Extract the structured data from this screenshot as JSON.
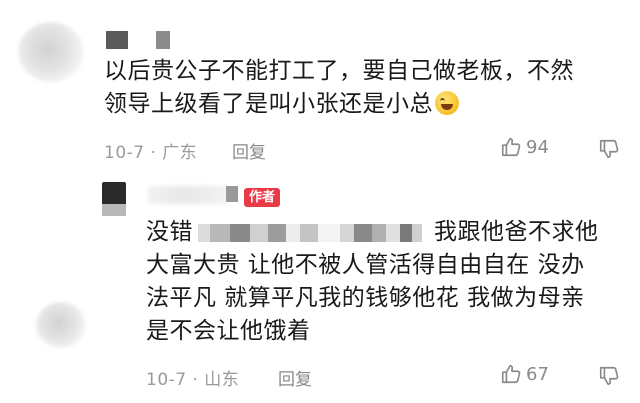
{
  "comments": [
    {
      "text_line1": "以后贵公子不能打工了，要自己做老板，不然",
      "text_line2": "领导上级看了是叫小张还是小总",
      "emoji": "rofl-emoji",
      "meta": "10-7 · 广东",
      "reply_label": "回复",
      "like_count": "94"
    },
    {
      "author_badge": "作者",
      "text_line1_prefix": "没错",
      "text_line1_suffix": "我跟他爸不求他",
      "text_line2": "大富大贵 让他不被人管活得自由自在 没办",
      "text_line3": "法平凡 就算平凡我的钱够他花 我做为母亲",
      "text_line4": "是不会让他饿着",
      "meta": "10-7 · 山东",
      "reply_label": "回复",
      "like_count": "67"
    }
  ],
  "icons": {
    "like": "thumbs-up-icon",
    "dislike": "thumbs-down-icon"
  },
  "colors": {
    "badge": "#ea3a47",
    "meta_text": "#9a9a9a"
  }
}
